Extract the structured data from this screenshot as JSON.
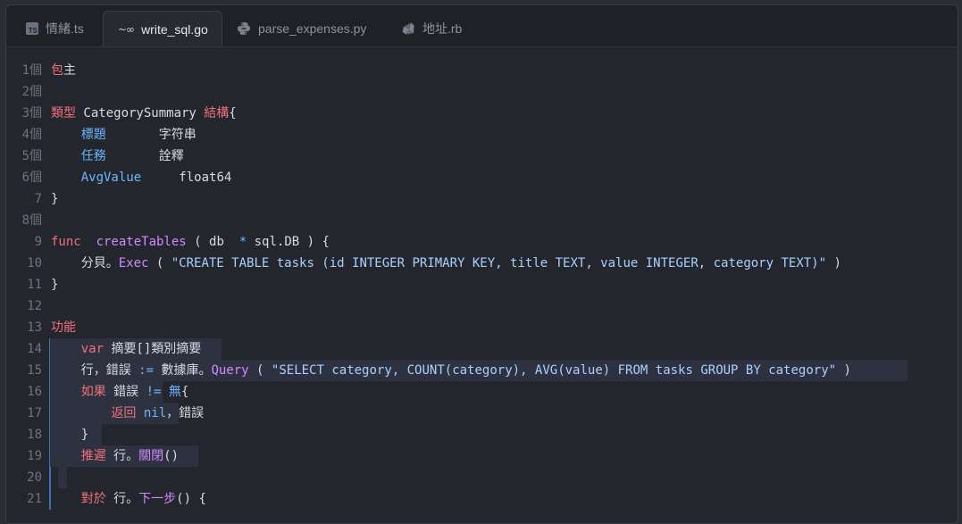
{
  "tabs": [
    {
      "label": "情緒.ts",
      "icon": "typescript-icon",
      "active": false
    },
    {
      "label": "write_sql.go",
      "icon": "go-icon",
      "active": true
    },
    {
      "label": "parse_expenses.py",
      "icon": "python-icon",
      "active": false
    },
    {
      "label": "地址.rb",
      "icon": "ruby-icon",
      "active": false
    }
  ],
  "icons": {
    "ts_text": "TS",
    "go_text": "~∞"
  },
  "lines": [
    {
      "n": "1個",
      "t": [
        [
          "kw",
          "包"
        ],
        [
          "plain",
          "主"
        ]
      ]
    },
    {
      "n": "2個",
      "t": []
    },
    {
      "n": "3個",
      "t": [
        [
          "kw",
          "類型"
        ],
        [
          "plain",
          " CategorySummary "
        ],
        [
          "kw",
          "結構"
        ],
        [
          "plain",
          "{"
        ]
      ]
    },
    {
      "n": "4個",
      "t": [
        [
          "plain",
          "    "
        ],
        [
          "fld",
          "標題"
        ],
        [
          "plain",
          "       字符串"
        ]
      ]
    },
    {
      "n": "5個",
      "t": [
        [
          "plain",
          "    "
        ],
        [
          "fld",
          "任務"
        ],
        [
          "plain",
          "       詮釋"
        ]
      ]
    },
    {
      "n": "6個",
      "t": [
        [
          "plain",
          "    "
        ],
        [
          "fld",
          "AvgValue"
        ],
        [
          "plain",
          "     float64"
        ]
      ]
    },
    {
      "n": "7",
      "t": [
        [
          "plain",
          "}"
        ]
      ]
    },
    {
      "n": "8個",
      "t": []
    },
    {
      "n": "9",
      "t": [
        [
          "kw",
          "func"
        ],
        [
          "plain",
          "  "
        ],
        [
          "fn",
          "createTables"
        ],
        [
          "plain",
          " ( db  "
        ],
        [
          "op",
          "*"
        ],
        [
          "plain",
          " sql.DB ) {"
        ]
      ]
    },
    {
      "n": "10",
      "t": [
        [
          "plain",
          "    分貝。"
        ],
        [
          "fn",
          "Exec"
        ],
        [
          "plain",
          " ( "
        ],
        [
          "str",
          "\"CREATE TABLE tasks (id INTEGER PRIMARY KEY, title TEXT, value INTEGER, category TEXT)\""
        ],
        [
          "plain",
          " )"
        ]
      ]
    },
    {
      "n": "11",
      "t": [
        [
          "plain",
          "}"
        ]
      ]
    },
    {
      "n": "12",
      "t": []
    },
    {
      "n": "13",
      "t": [
        [
          "kw",
          "功能"
        ]
      ]
    },
    {
      "n": "14",
      "t": [
        [
          "plain",
          "    "
        ],
        [
          "kw",
          "var"
        ],
        [
          "plain",
          " 摘要[]類別摘要"
        ]
      ]
    },
    {
      "n": "15",
      "t": [
        [
          "plain",
          "    行，錯誤 "
        ],
        [
          "op",
          ":="
        ],
        [
          "plain",
          " 數據庫。"
        ],
        [
          "fn",
          "Query"
        ],
        [
          "plain",
          " ( "
        ],
        [
          "str",
          "\"SELECT category, COUNT(category), AVG(value) FROM tasks GROUP BY category\""
        ],
        [
          "plain",
          " )"
        ]
      ]
    },
    {
      "n": "16",
      "t": [
        [
          "plain",
          "    "
        ],
        [
          "kw",
          "如果"
        ],
        [
          "plain",
          " 錯誤 "
        ],
        [
          "op",
          "!="
        ],
        [
          "plain",
          " "
        ],
        [
          "fld",
          "無"
        ],
        [
          "plain",
          "{"
        ]
      ]
    },
    {
      "n": "17",
      "t": [
        [
          "plain",
          "        "
        ],
        [
          "kw",
          "返回"
        ],
        [
          "plain",
          " "
        ],
        [
          "nil",
          "nil"
        ],
        [
          "plain",
          "，錯誤"
        ]
      ]
    },
    {
      "n": "18",
      "t": [
        [
          "plain",
          "    }"
        ]
      ]
    },
    {
      "n": "19",
      "t": [
        [
          "plain",
          "    "
        ],
        [
          "kw",
          "推遲"
        ],
        [
          "plain",
          " 行。"
        ],
        [
          "fn",
          "關閉"
        ],
        [
          "plain",
          "()"
        ]
      ]
    },
    {
      "n": "20",
      "t": []
    },
    {
      "n": "21",
      "t": [
        [
          "plain",
          "    "
        ],
        [
          "kw",
          "對於"
        ],
        [
          "plain",
          " 行。"
        ],
        [
          "fn",
          "下一步"
        ],
        [
          "plain",
          "() {"
        ]
      ]
    }
  ]
}
